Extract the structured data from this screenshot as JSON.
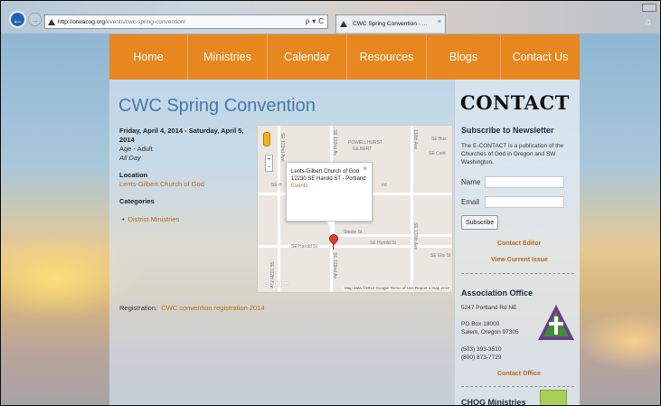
{
  "browser": {
    "url_domain": "http://orwacog.org",
    "url_path": "/events/cwc-spring-convention/",
    "search_ctrl": "ρ",
    "dropdown_ctrl": "▾",
    "refresh_ctrl": "C",
    "tab_title": "CWC Spring Convention - ...",
    "tab_close": "×",
    "back_glyph": "←",
    "fwd_glyph": "→",
    "home_glyph": "⌂"
  },
  "nav": {
    "items": [
      "Home",
      "Ministries",
      "Calendar",
      "Resources",
      "Blogs",
      "Contact Us"
    ]
  },
  "event": {
    "title": "CWC Spring Convention",
    "dates": "Friday, April 4, 2014 - Saturday, April 5, 2014",
    "age": "Age - Adult",
    "time": "All Day",
    "location_label": "Location",
    "location_link": "Lents-Gilbert Church of God",
    "categories_label": "Categories",
    "bullet": "•",
    "category_item": "District Ministries",
    "registration_label": "Registration:",
    "registration_link": "CWC convention registration 2014"
  },
  "map": {
    "streets": {
      "powellhurst": "POWELLHURST",
      "gilbert": "GILBERT",
      "se_bus": "SE Bus",
      "se_cent": "SE Cent",
      "se_h": "SE H",
      "ed": "ed",
      "steele": "Steele St",
      "harold_a": "SE Harold St",
      "harold_b": "SE Harold St",
      "ellis": "SE Elis St",
      "ave_122": "SE 122nd Av",
      "ave_122_b": "SE 122nd Av",
      "ave_122_c": "SE 122nd Ave",
      "ave_130": "130th Ave",
      "ave_130_b": "SE 130th Ave",
      "ave_112": "SE 112th Ave"
    },
    "popup_name": "Lents-Gilbert Church of God",
    "popup_address": "12230 SE Harold ST - Portland",
    "popup_link": "Events",
    "popup_close": "×",
    "zoom_in": "+",
    "zoom_out": "−",
    "logo": "Google",
    "footer": "Map data ©2014 Google   Terms of Use   Report a map error"
  },
  "sidebar": {
    "logo_text": "CONTACT",
    "newsletter_title": "Subscribe to Newsletter",
    "newsletter_desc": "The E-CONTACT is a publication of the Churches of God in Oregon and SW Washington.",
    "name_label": "Name",
    "email_label": "Email",
    "subscribe_label": "Subscribe",
    "contact_editor": "Contact Editor",
    "view_issue": "View Current Issue",
    "assoc_title": "Association Office",
    "address_line": "5247 Portland Rd NE",
    "po_box": "PO Box 18000",
    "city": "Salem, Oregon 97305",
    "phone_1": "(503) 393-3510",
    "phone_2": "(800) 873-7729",
    "contact_office": "Contact Office",
    "cog_heading": "CHOG Ministries"
  },
  "colors": {
    "nav_orange": "#e8871f",
    "title_blue": "#4879a9",
    "link_orange": "#b56a1a"
  }
}
